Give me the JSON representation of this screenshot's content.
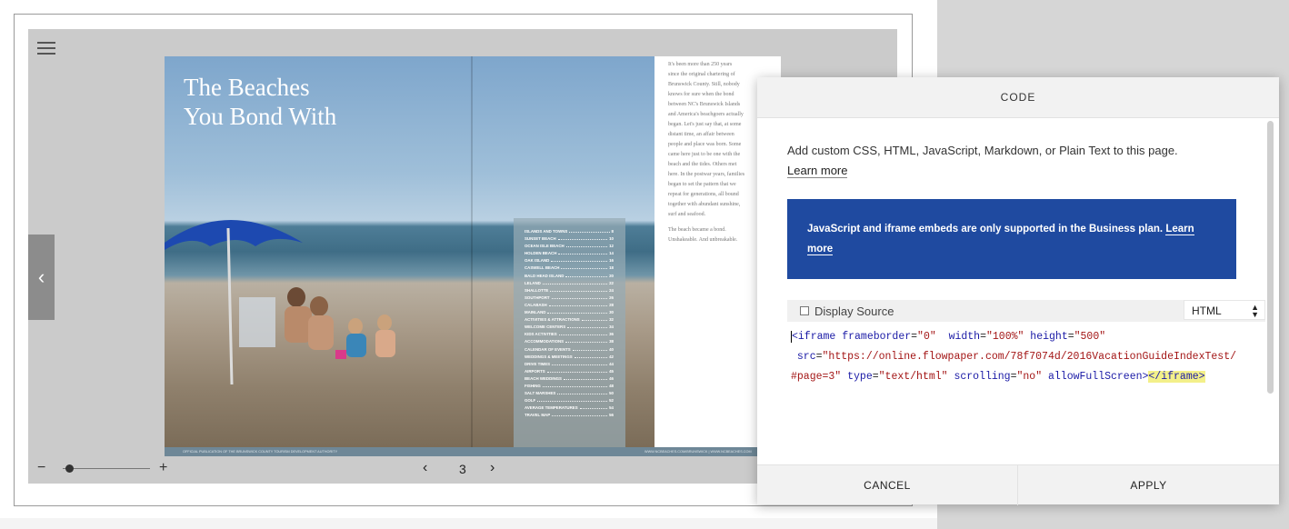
{
  "viewer": {
    "menu_icon": "hamburger-icon",
    "prev_icon": "chevron-left-icon",
    "page_number": "3",
    "zoom_minus": "−",
    "zoom_plus": "+",
    "zoom_level": 0.05
  },
  "spread": {
    "headline_line1": "The Beaches",
    "headline_line2": "You Bond With",
    "toc": [
      {
        "title": "ISLANDS AND TOWNS",
        "page": "8"
      },
      {
        "title": "SUNSET BEACH",
        "page": "10"
      },
      {
        "title": "OCEAN ISLE BEACH",
        "page": "12"
      },
      {
        "title": "HOLDEN BEACH",
        "page": "14"
      },
      {
        "title": "OAK ISLAND",
        "page": "16"
      },
      {
        "title": "CASWELL BEACH",
        "page": "18"
      },
      {
        "title": "BALD HEAD ISLAND",
        "page": "20"
      },
      {
        "title": "LELAND",
        "page": "22"
      },
      {
        "title": "SHALLOTTE",
        "page": "24"
      },
      {
        "title": "SOUTHPORT",
        "page": "26"
      },
      {
        "title": "CALABASH",
        "page": "28"
      },
      {
        "title": "MAINLAND",
        "page": "30"
      },
      {
        "title": "ACTIVITIES & ATTRACTIONS",
        "page": "32"
      },
      {
        "title": "WELCOME CENTERS",
        "page": "34"
      },
      {
        "title": "KIDS ACTIVITIES",
        "page": "36"
      },
      {
        "title": "ACCOMMODATIONS",
        "page": "38"
      },
      {
        "title": "CALENDAR OF EVENTS",
        "page": "40"
      },
      {
        "title": "WEDDINGS & MEETINGS",
        "page": "42"
      },
      {
        "title": "DRIVE TIMES",
        "page": "44"
      },
      {
        "title": "AIRPORTS",
        "page": "45"
      },
      {
        "title": "BEACH WEDDINGS",
        "page": "46"
      },
      {
        "title": "FISHING",
        "page": "48"
      },
      {
        "title": "SALT MARSHES",
        "page": "50"
      },
      {
        "title": "GOLF",
        "page": "52"
      },
      {
        "title": "AVERAGE TEMPERATURES",
        "page": "54"
      },
      {
        "title": "TRAVEL MAP",
        "page": "56"
      }
    ],
    "article_p1": "It's been more than 250 years\nsince the original chartering of\nBrunswick County. Still, nobody\nknows for sure when the bond\nbetween NC's Brunswick Islands\nand America's beachgoers actually\nbegan. Let's just say that, at some\ndistant time, an affair between\npeople and place was born. Some\ncame here just to be one with the\nbeach and the tides. Others met\nhere. In the postwar years, families\nbegan to set the pattern that we\nrepeat for generations, all bound\ntogether with abundant sunshine,\nsurf and seafood.",
    "article_p2": "The beach became a bond.\nUnshakeable. And unbreakable.",
    "footer_left": "OFFICIAL PUBLICATION OF THE BRUNSWICK COUNTY TOURISM DEVELOPMENT AUTHORITY",
    "footer_right": "WWW.NCBEACHES.COM/BRUNSWICK | WWW.NCBEACHES.COM"
  },
  "dialog": {
    "title": "CODE",
    "intro_text": "Add custom CSS, HTML, JavaScript, Markdown, or Plain Text to this page.",
    "learn_more": "Learn more",
    "notice_text": "JavaScript and iframe embeds are only supported in the Business plan.",
    "notice_link_1": "Learn",
    "notice_link_2": "more",
    "display_source_label": "Display Source",
    "language_selected": "HTML",
    "code": {
      "l1_open": "<iframe",
      "l1_attr1": " frameborder",
      "l1_eq1": "=",
      "l1_val1": "\"0\"",
      "l1_attr2": "  width",
      "l1_eq2": "=",
      "l1_val2": "\"100%\"",
      "l1_attr3": " height",
      "l1_eq3": "=",
      "l1_val3": "\"500\"",
      "l2_attr": " src",
      "l2_eq": "=",
      "l2_val": "\"https://online.flowpaper.com/78f7074d/2016VacationGuideIndexTest/",
      "l3_val": "#page=3\"",
      "l3_attr1": " type",
      "l3_eq1": "=",
      "l3_val1": "\"text/html\"",
      "l3_attr2": " scrolling",
      "l3_eq2": "=",
      "l3_val2": "\"no\"",
      "l3_attr3": " allowFullScreen",
      "l3_gt": ">",
      "l3_close": "</iframe>"
    },
    "cancel_label": "CANCEL",
    "apply_label": "APPLY"
  }
}
